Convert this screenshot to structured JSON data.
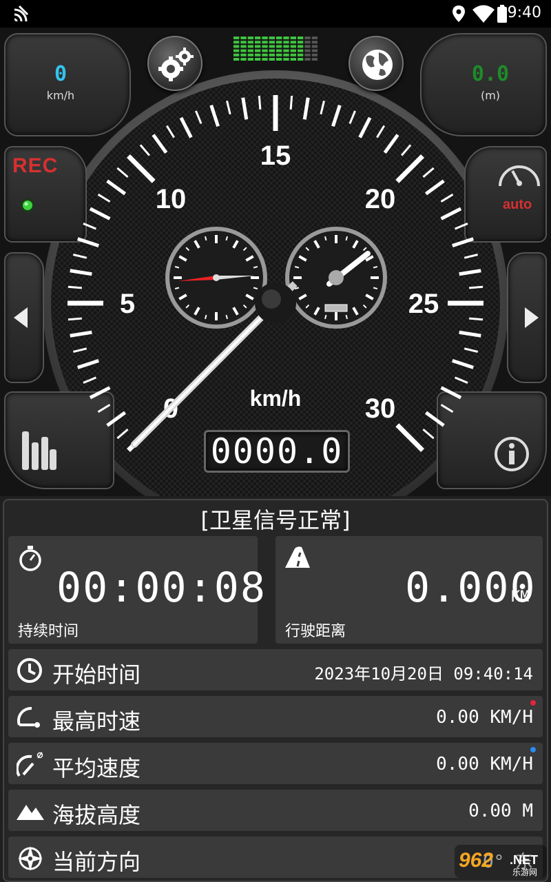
{
  "status_bar": {
    "time": "09:40"
  },
  "top_left_readout": {
    "value": "0",
    "unit": "km/h",
    "color": "#33c4ee"
  },
  "top_right_readout": {
    "value": "0.0",
    "unit": "(m)",
    "color": "#1f8a2a"
  },
  "rec_label": "REC",
  "auto_label": "auto",
  "gauge": {
    "tick_labels": [
      "0",
      "5",
      "10",
      "15",
      "20",
      "25",
      "30"
    ],
    "unit": "km/h",
    "speed": 0,
    "odometer": "0000.0"
  },
  "signal_level": {
    "lit": 10,
    "total": 12
  },
  "stats": {
    "gps_status": "[卫星信号正常]",
    "duration": {
      "value": "00:00:08",
      "label": "持续时间"
    },
    "distance": {
      "value": "0.000",
      "unit": "KM",
      "label": "行驶距离"
    },
    "start_time": {
      "label": "开始时间",
      "value": "2023年10月20日 09:40:14"
    },
    "max_speed": {
      "label": "最高时速",
      "value": "0.00 KM/H",
      "dot_color": "#e0263a"
    },
    "avg_speed": {
      "label": "平均速度",
      "value": "0.00 KM/H",
      "dot_color": "#2a8cf0"
    },
    "altitude": {
      "label": "海拔高度",
      "value": "0.00 M"
    },
    "heading": {
      "label": "当前方向",
      "value": "0° 东"
    }
  },
  "watermark": {
    "text": "962",
    "suffix": ".NET",
    "sub": "乐游网"
  }
}
